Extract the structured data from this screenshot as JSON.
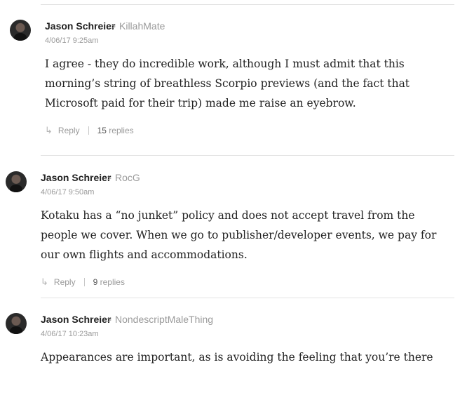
{
  "comments": [
    {
      "author": "Jason Schreier",
      "reply_to": "KillahMate",
      "timestamp": "4/06/17 9:25am",
      "body": "I agree - they do incredible work, although I must admit that this morning’s string of breathless Scorpio previews (and the fact that Microsoft paid for their trip) made me raise an eyebrow.",
      "reply_label": "Reply",
      "reply_count": "15",
      "replies_label": "replies"
    },
    {
      "author": "Jason Schreier",
      "reply_to": "RocG",
      "timestamp": "4/06/17 9:50am",
      "body": "Kotaku has a “no junket” policy and does not accept travel from the people we cover. When we go to publisher/developer events, we pay for our own flights and accommodations.",
      "reply_label": "Reply",
      "reply_count": "9",
      "replies_label": "replies"
    },
    {
      "author": "Jason Schreier",
      "reply_to": "NondescriptMaleThing",
      "timestamp": "4/06/17 10:23am",
      "body": "Appearances are important, as is avoiding the feeling that you’re there"
    }
  ]
}
